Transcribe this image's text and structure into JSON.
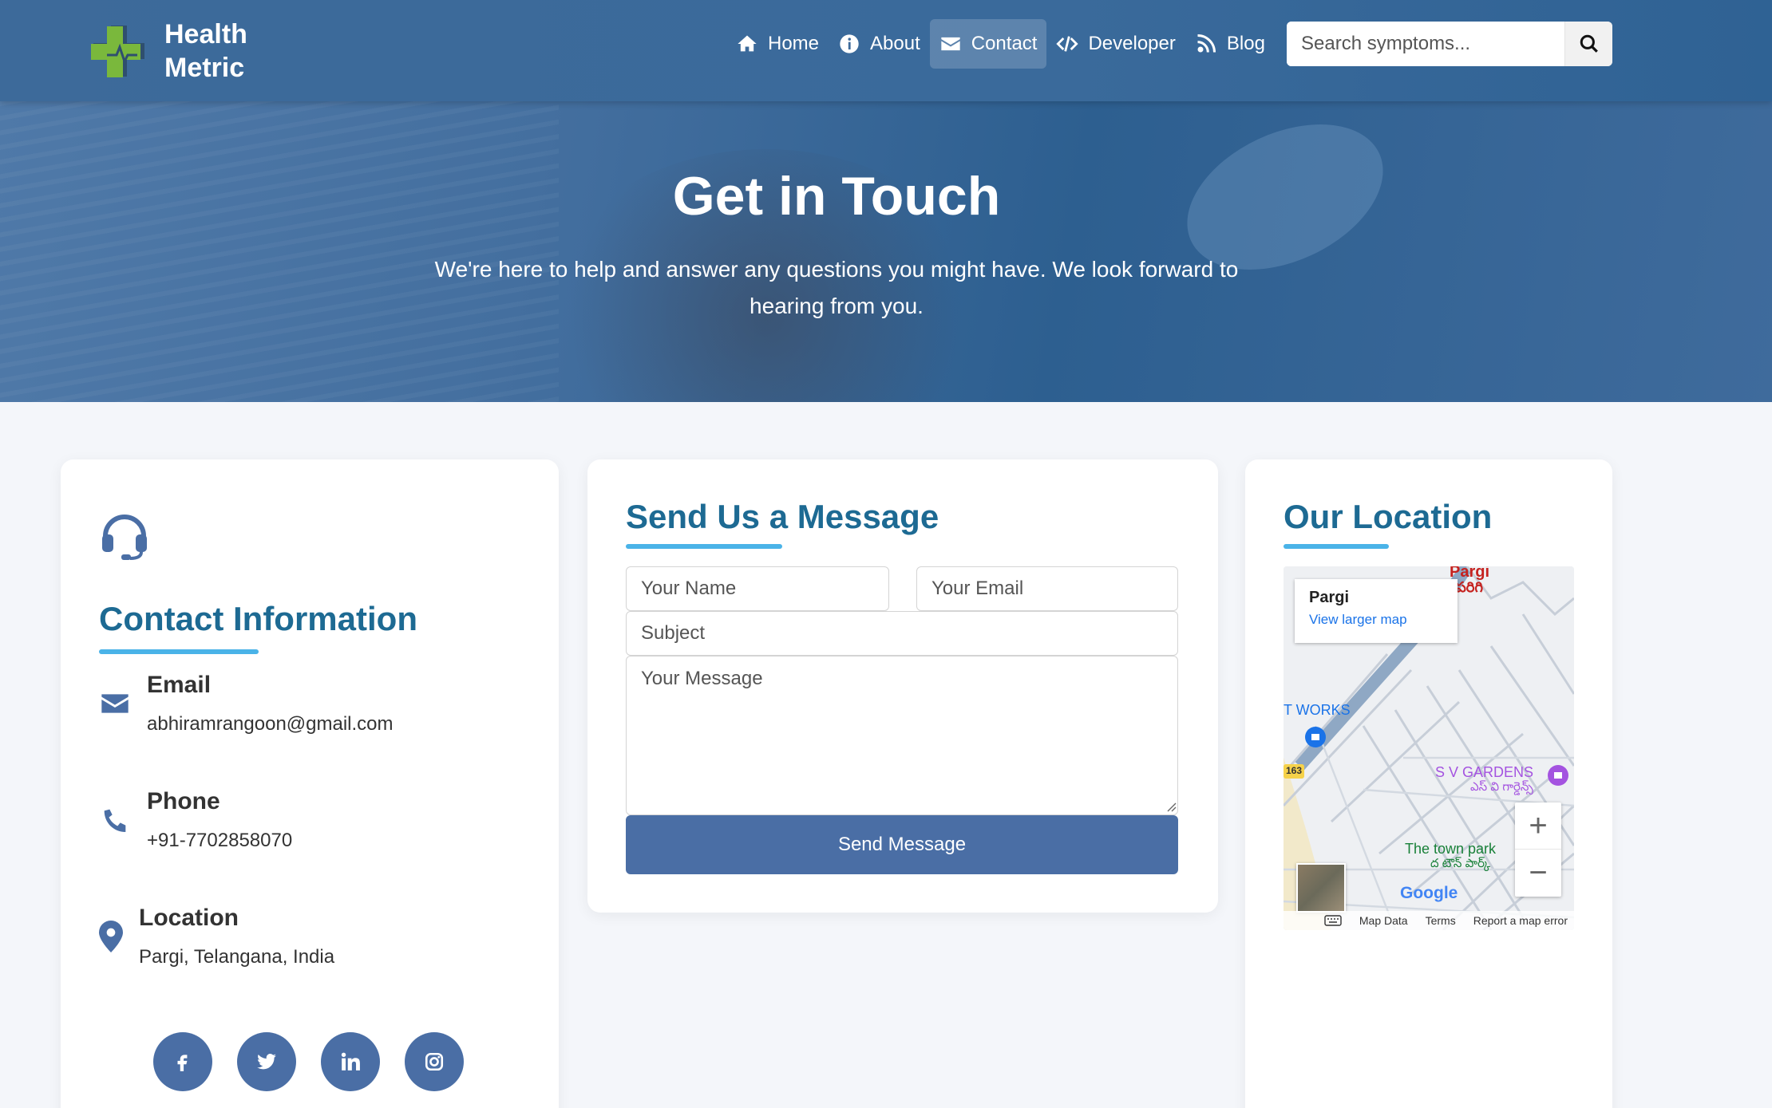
{
  "brand": {
    "line1": "Health",
    "line2": "Metric",
    "colors": {
      "primary": "#4a6ea5",
      "accent": "#4ab3e8",
      "heading": "#1d6a93",
      "logo_green": "#7ab83c"
    }
  },
  "nav": {
    "items": [
      {
        "label": "Home",
        "icon": "home-icon"
      },
      {
        "label": "About",
        "icon": "info-icon"
      },
      {
        "label": "Contact",
        "icon": "envelope-icon",
        "active": true
      },
      {
        "label": "Developer",
        "icon": "code-icon"
      },
      {
        "label": "Blog",
        "icon": "rss-icon"
      }
    ]
  },
  "search": {
    "placeholder": "Search symptoms...",
    "icon": "search-icon"
  },
  "hero": {
    "title": "Get in Touch",
    "subtitle": "We're here to help and answer any questions you might have. We look forward to hearing from you."
  },
  "contact_info": {
    "icon": "headset-icon",
    "title": "Contact Information",
    "items": [
      {
        "label": "Email",
        "value": "abhiramrangoon@gmail.com",
        "icon": "envelope-icon"
      },
      {
        "label": "Phone",
        "value": "+91-7702858070",
        "icon": "phone-icon"
      },
      {
        "label": "Location",
        "value": "Pargi, Telangana, India",
        "icon": "map-pin-icon"
      }
    ],
    "socials": [
      "facebook-icon",
      "twitter-icon",
      "linkedin-icon",
      "instagram-icon"
    ]
  },
  "form": {
    "title": "Send Us a Message",
    "name_placeholder": "Your Name",
    "email_placeholder": "Your Email",
    "subject_placeholder": "Subject",
    "message_placeholder": "Your Message",
    "submit_label": "Send Message"
  },
  "location": {
    "title": "Our Location",
    "map": {
      "place_name": "Pargi",
      "larger_map_link": "View larger map",
      "labels": [
        "Pargi",
        "పరిగి",
        "T WORKS",
        "S V GARDENS",
        "ఎస్ వి గార్డెన్స్",
        "The town park",
        "ద టౌన్ పార్క్",
        "163"
      ],
      "footer": [
        "Map Data",
        "Terms",
        "Report a map error"
      ],
      "brand": "Google"
    }
  }
}
